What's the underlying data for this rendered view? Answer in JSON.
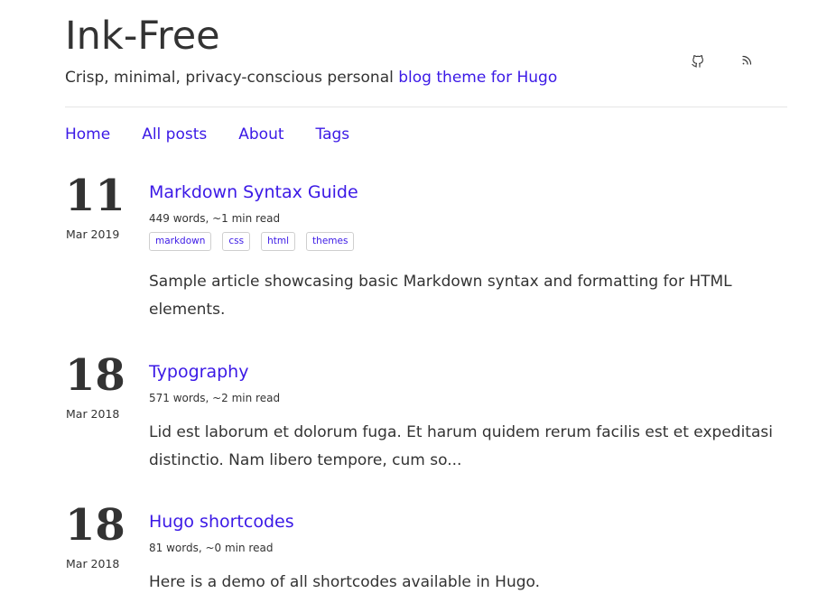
{
  "site": {
    "title": "Ink-Free",
    "tagline_prefix": "Crisp, minimal, privacy-conscious personal ",
    "tagline_link": "blog theme for Hugo"
  },
  "header_icons": [
    "github-icon",
    "rss-icon"
  ],
  "nav": [
    {
      "label": "Home"
    },
    {
      "label": "All posts"
    },
    {
      "label": "About"
    },
    {
      "label": "Tags"
    }
  ],
  "posts": [
    {
      "day": "11",
      "month": "Mar 2019",
      "title": "Markdown Syntax Guide",
      "meta": "449 words, ~1 min read",
      "tags": [
        "markdown",
        "css",
        "html",
        "themes"
      ],
      "summary": "Sample article showcasing basic Markdown syntax and formatting for HTML elements."
    },
    {
      "day": "18",
      "month": "Mar 2018",
      "title": "Typography",
      "meta": "571 words, ~2 min read",
      "tags": [],
      "summary": "Lid est laborum et dolorum fuga. Et harum quidem rerum facilis est et expeditasi distinctio. Nam libero tempore, cum so..."
    },
    {
      "day": "18",
      "month": "Mar 2018",
      "title": "Hugo shortcodes",
      "meta": "81 words, ~0 min read",
      "tags": [],
      "summary": "Here is a demo of all shortcodes available in Hugo."
    }
  ],
  "colors": {
    "link": "#3b19e6",
    "text": "#333333",
    "divider": "#e6e6e6"
  }
}
